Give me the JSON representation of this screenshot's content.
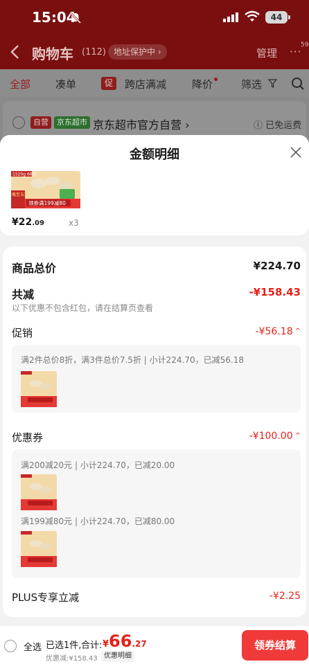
{
  "status_bar": {
    "time": "15:04",
    "battery": "44"
  },
  "nav": {
    "title": "购物车",
    "count": "(112)",
    "address": "地址保护中 ›",
    "manage": "管理",
    "more": "···",
    "more_badge": "59"
  },
  "filters": {
    "all": "全部",
    "cou": "凑单",
    "promo_tag": "促",
    "cross_store": "跨店满减",
    "price_drop": "降价",
    "filter": "筛选"
  },
  "store": {
    "self_tag": "自营",
    "supermarket_tag": "京东超市",
    "name": "京东超市官方自营 ›",
    "shipping": "ⓘ 已免运费"
  },
  "sheet": {
    "title": "金额明细"
  },
  "product": {
    "price_int": "¥22",
    "price_dec": ".09",
    "qty": "x3",
    "thumb_lines": [
      "1520g 66只",
      "领券满199减80",
      "瓶至五折"
    ]
  },
  "details": {
    "total_label": "商品总价",
    "total_value": "¥224.70",
    "reduce_label": "共减",
    "reduce_value": "-¥158.43",
    "reduce_note": "以下优惠不包含红包，请在结算页查看",
    "promo_label": "促销",
    "promo_value": "-¥56.18",
    "promo_rule": "满2件总价8折，满3件总价7.5折 | 小计224.70，已减56.18",
    "coupon_label": "优惠券",
    "coupon_value": "-¥100.00",
    "coupon_rules": [
      "满200减20元 | 小计224.70，已减20.00",
      "满199减80元 | 小计224.70，已减80.00"
    ],
    "plus_label": "PLUS专享立减",
    "plus_value": "-¥2.25",
    "chevron": "^"
  },
  "bottom": {
    "select_all": "全选",
    "selected": "已选1件,",
    "total_label": "合计:",
    "currency": "¥",
    "amount_int": "66",
    "amount_dec": ".27",
    "saved": "优惠减:¥158.43",
    "detail_link": "优惠明细",
    "checkout": "领券结算"
  },
  "colors": {
    "accent": "#e2231a",
    "checkout": "#f03a3a",
    "header": "#7a0f0f"
  }
}
